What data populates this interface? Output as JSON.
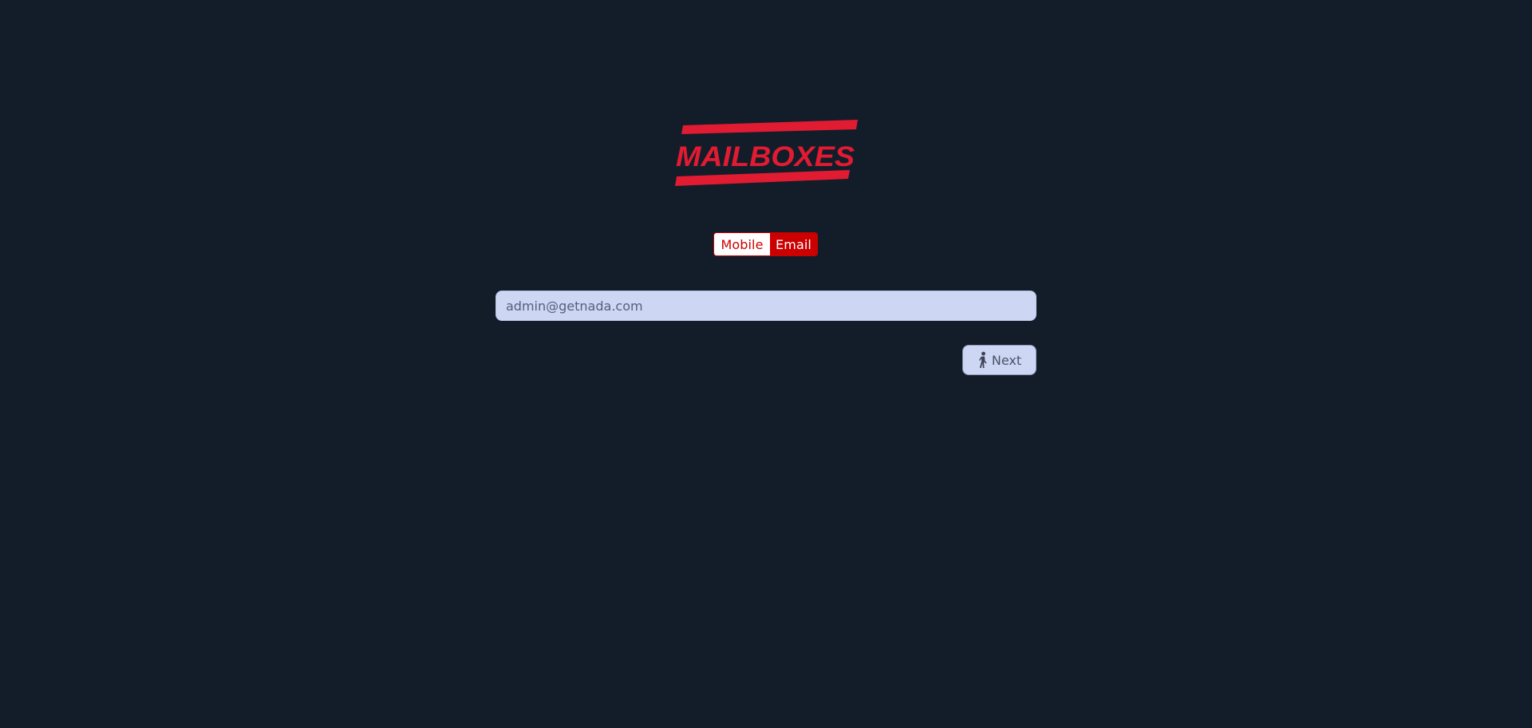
{
  "brand": {
    "logo_text": "MAILBOXES",
    "logo_color": "#e01b32"
  },
  "login_mode_toggle": {
    "options": [
      "Mobile",
      "Email"
    ],
    "selected": "Email",
    "accent_color": "#cc0000"
  },
  "email_field": {
    "value": "admin@getnada.com"
  },
  "next_button": {
    "label": "Next",
    "icon": "person-walking-icon"
  },
  "colors": {
    "background": "#131d29",
    "input_background": "#cdd7f3"
  }
}
